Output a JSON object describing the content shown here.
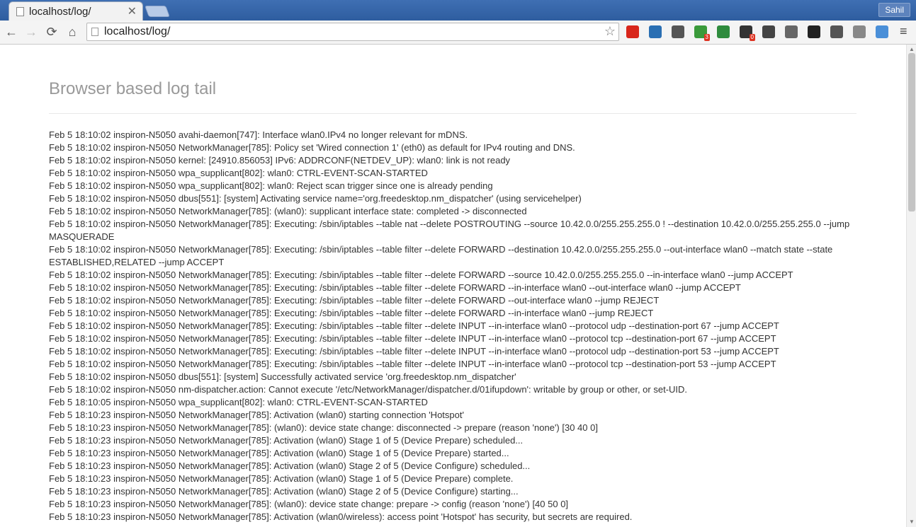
{
  "browser": {
    "tab": {
      "title": "localhost/log/",
      "close": "✕"
    },
    "profile_name": "Sahil",
    "address": {
      "url": "localhost/log/"
    },
    "nav": {
      "back": "←",
      "forward": "→",
      "reload": "⟳",
      "home": "⌂",
      "star": "☆",
      "menu": "≡"
    },
    "extensions": [
      {
        "name": "adblock-icon",
        "color": "#d8261b",
        "badge": ""
      },
      {
        "name": "amazon-icon",
        "color": "#2a6fb3",
        "badge": ""
      },
      {
        "name": "pocket-icon",
        "color": "#555555",
        "badge": ""
      },
      {
        "name": "green-ext-icon",
        "color": "#3a9a3a",
        "badge": "3"
      },
      {
        "name": "share-icon",
        "color": "#2e8b3d",
        "badge": ""
      },
      {
        "name": "screencast-icon",
        "color": "#333333",
        "badge": "0"
      },
      {
        "name": "film-icon",
        "color": "#444444",
        "badge": ""
      },
      {
        "name": "speaker-icon",
        "color": "#666666",
        "badge": ""
      },
      {
        "name": "spy-icon",
        "color": "#222222",
        "badge": ""
      },
      {
        "name": "tag-icon",
        "color": "#555555",
        "badge": ""
      },
      {
        "name": "clock-icon",
        "color": "#888888",
        "badge": ""
      },
      {
        "name": "person-icon",
        "color": "#4a8fd8",
        "badge": ""
      }
    ]
  },
  "page": {
    "title": "Browser based log tail",
    "log_lines": [
      "Feb 5 18:10:02 inspiron-N5050 avahi-daemon[747]: Interface wlan0.IPv4 no longer relevant for mDNS.",
      "Feb 5 18:10:02 inspiron-N5050 NetworkManager[785]: Policy set 'Wired connection 1' (eth0) as default for IPv4 routing and DNS.",
      "Feb 5 18:10:02 inspiron-N5050 kernel: [24910.856053] IPv6: ADDRCONF(NETDEV_UP): wlan0: link is not ready",
      "Feb 5 18:10:02 inspiron-N5050 wpa_supplicant[802]: wlan0: CTRL-EVENT-SCAN-STARTED",
      "Feb 5 18:10:02 inspiron-N5050 wpa_supplicant[802]: wlan0: Reject scan trigger since one is already pending",
      "Feb 5 18:10:02 inspiron-N5050 dbus[551]: [system] Activating service name='org.freedesktop.nm_dispatcher' (using servicehelper)",
      "Feb 5 18:10:02 inspiron-N5050 NetworkManager[785]: (wlan0): supplicant interface state: completed -> disconnected",
      "Feb 5 18:10:02 inspiron-N5050 NetworkManager[785]: Executing: /sbin/iptables --table nat --delete POSTROUTING --source 10.42.0.0/255.255.255.0 ! --destination 10.42.0.0/255.255.255.0 --jump MASQUERADE",
      "Feb 5 18:10:02 inspiron-N5050 NetworkManager[785]: Executing: /sbin/iptables --table filter --delete FORWARD --destination 10.42.0.0/255.255.255.0 --out-interface wlan0 --match state --state ESTABLISHED,RELATED --jump ACCEPT",
      "Feb 5 18:10:02 inspiron-N5050 NetworkManager[785]: Executing: /sbin/iptables --table filter --delete FORWARD --source 10.42.0.0/255.255.255.0 --in-interface wlan0 --jump ACCEPT",
      "Feb 5 18:10:02 inspiron-N5050 NetworkManager[785]: Executing: /sbin/iptables --table filter --delete FORWARD --in-interface wlan0 --out-interface wlan0 --jump ACCEPT",
      "Feb 5 18:10:02 inspiron-N5050 NetworkManager[785]: Executing: /sbin/iptables --table filter --delete FORWARD --out-interface wlan0 --jump REJECT",
      "Feb 5 18:10:02 inspiron-N5050 NetworkManager[785]: Executing: /sbin/iptables --table filter --delete FORWARD --in-interface wlan0 --jump REJECT",
      "Feb 5 18:10:02 inspiron-N5050 NetworkManager[785]: Executing: /sbin/iptables --table filter --delete INPUT --in-interface wlan0 --protocol udp --destination-port 67 --jump ACCEPT",
      "Feb 5 18:10:02 inspiron-N5050 NetworkManager[785]: Executing: /sbin/iptables --table filter --delete INPUT --in-interface wlan0 --protocol tcp --destination-port 67 --jump ACCEPT",
      "Feb 5 18:10:02 inspiron-N5050 NetworkManager[785]: Executing: /sbin/iptables --table filter --delete INPUT --in-interface wlan0 --protocol udp --destination-port 53 --jump ACCEPT",
      "Feb 5 18:10:02 inspiron-N5050 NetworkManager[785]: Executing: /sbin/iptables --table filter --delete INPUT --in-interface wlan0 --protocol tcp --destination-port 53 --jump ACCEPT",
      "Feb 5 18:10:02 inspiron-N5050 dbus[551]: [system] Successfully activated service 'org.freedesktop.nm_dispatcher'",
      "Feb 5 18:10:02 inspiron-N5050 nm-dispatcher.action: Cannot execute '/etc/NetworkManager/dispatcher.d/01ifupdown': writable by group or other, or set-UID.",
      "Feb 5 18:10:05 inspiron-N5050 wpa_supplicant[802]: wlan0: CTRL-EVENT-SCAN-STARTED",
      "Feb 5 18:10:23 inspiron-N5050 NetworkManager[785]: Activation (wlan0) starting connection 'Hotspot'",
      "Feb 5 18:10:23 inspiron-N5050 NetworkManager[785]: (wlan0): device state change: disconnected -> prepare (reason 'none') [30 40 0]",
      "Feb 5 18:10:23 inspiron-N5050 NetworkManager[785]: Activation (wlan0) Stage 1 of 5 (Device Prepare) scheduled...",
      "Feb 5 18:10:23 inspiron-N5050 NetworkManager[785]: Activation (wlan0) Stage 1 of 5 (Device Prepare) started...",
      "Feb 5 18:10:23 inspiron-N5050 NetworkManager[785]: Activation (wlan0) Stage 2 of 5 (Device Configure) scheduled...",
      "Feb 5 18:10:23 inspiron-N5050 NetworkManager[785]: Activation (wlan0) Stage 1 of 5 (Device Prepare) complete.",
      "Feb 5 18:10:23 inspiron-N5050 NetworkManager[785]: Activation (wlan0) Stage 2 of 5 (Device Configure) starting...",
      "Feb 5 18:10:23 inspiron-N5050 NetworkManager[785]: (wlan0): device state change: prepare -> config (reason 'none') [40 50 0]",
      "Feb 5 18:10:23 inspiron-N5050 NetworkManager[785]: Activation (wlan0/wireless): access point 'Hotspot' has security, but secrets are required."
    ]
  }
}
